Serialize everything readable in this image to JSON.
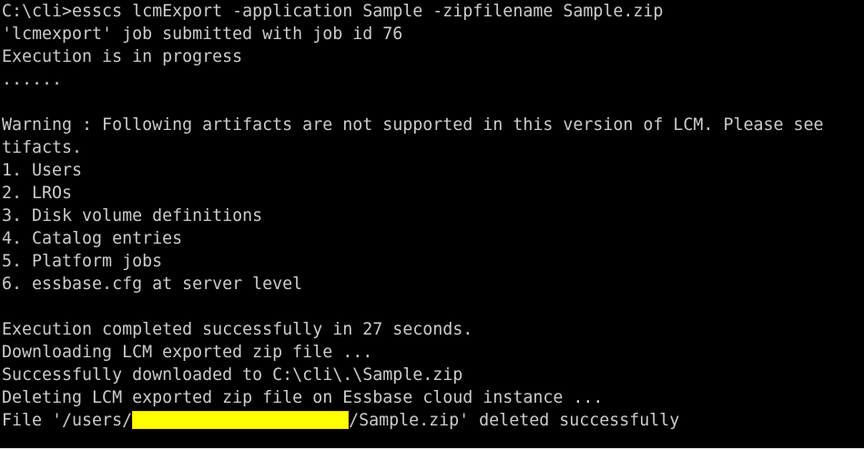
{
  "terminal": {
    "background_color": "#000000",
    "text_color": "#cccccc",
    "redaction_color": "#ffff00",
    "lines": {
      "l01": "C:\\cli>esscs lcmExport -application Sample -zipfilename Sample.zip",
      "l02": "'lcmexport' job submitted with job id 76",
      "l03": "Execution is in progress",
      "l04": "......",
      "l05": "",
      "l06": "Warning : Following artifacts are not supported in this version of LCM. Please see",
      "l07": "tifacts.",
      "l08": "1. Users",
      "l09": "2. LROs",
      "l10": "3. Disk volume definitions",
      "l11": "4. Catalog entries",
      "l12": "5. Platform jobs",
      "l13": "6. essbase.cfg at server level",
      "l14": "",
      "l15": "Execution completed successfully in 27 seconds.",
      "l16": "Downloading LCM exported zip file ...",
      "l17": "Successfully downloaded to C:\\cli\\.\\Sample.zip",
      "l18": "Deleting LCM exported zip file on Essbase cloud instance ...",
      "l19_prefix": "File '/users/",
      "l19_suffix": "/Sample.zip' deleted successfully"
    }
  }
}
